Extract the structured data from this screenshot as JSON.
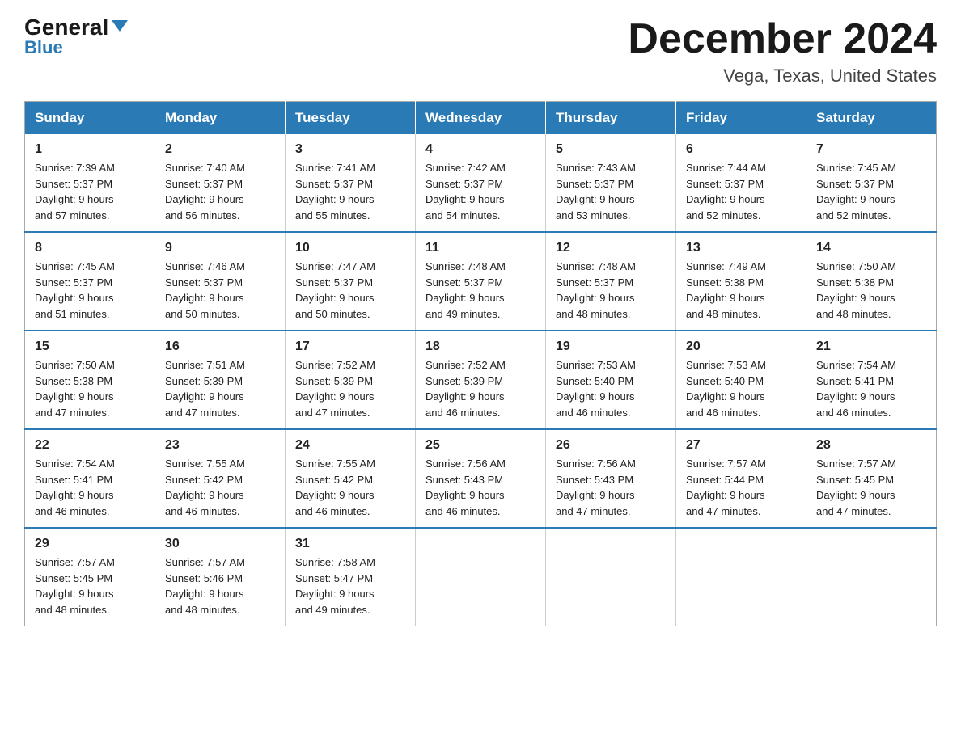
{
  "header": {
    "logo_general": "General",
    "logo_blue": "Blue",
    "month_title": "December 2024",
    "location": "Vega, Texas, United States"
  },
  "days_of_week": [
    "Sunday",
    "Monday",
    "Tuesday",
    "Wednesday",
    "Thursday",
    "Friday",
    "Saturday"
  ],
  "weeks": [
    [
      {
        "day": "1",
        "sunrise": "7:39 AM",
        "sunset": "5:37 PM",
        "daylight": "9 hours and 57 minutes."
      },
      {
        "day": "2",
        "sunrise": "7:40 AM",
        "sunset": "5:37 PM",
        "daylight": "9 hours and 56 minutes."
      },
      {
        "day": "3",
        "sunrise": "7:41 AM",
        "sunset": "5:37 PM",
        "daylight": "9 hours and 55 minutes."
      },
      {
        "day": "4",
        "sunrise": "7:42 AM",
        "sunset": "5:37 PM",
        "daylight": "9 hours and 54 minutes."
      },
      {
        "day": "5",
        "sunrise": "7:43 AM",
        "sunset": "5:37 PM",
        "daylight": "9 hours and 53 minutes."
      },
      {
        "day": "6",
        "sunrise": "7:44 AM",
        "sunset": "5:37 PM",
        "daylight": "9 hours and 52 minutes."
      },
      {
        "day": "7",
        "sunrise": "7:45 AM",
        "sunset": "5:37 PM",
        "daylight": "9 hours and 52 minutes."
      }
    ],
    [
      {
        "day": "8",
        "sunrise": "7:45 AM",
        "sunset": "5:37 PM",
        "daylight": "9 hours and 51 minutes."
      },
      {
        "day": "9",
        "sunrise": "7:46 AM",
        "sunset": "5:37 PM",
        "daylight": "9 hours and 50 minutes."
      },
      {
        "day": "10",
        "sunrise": "7:47 AM",
        "sunset": "5:37 PM",
        "daylight": "9 hours and 50 minutes."
      },
      {
        "day": "11",
        "sunrise": "7:48 AM",
        "sunset": "5:37 PM",
        "daylight": "9 hours and 49 minutes."
      },
      {
        "day": "12",
        "sunrise": "7:48 AM",
        "sunset": "5:37 PM",
        "daylight": "9 hours and 48 minutes."
      },
      {
        "day": "13",
        "sunrise": "7:49 AM",
        "sunset": "5:38 PM",
        "daylight": "9 hours and 48 minutes."
      },
      {
        "day": "14",
        "sunrise": "7:50 AM",
        "sunset": "5:38 PM",
        "daylight": "9 hours and 48 minutes."
      }
    ],
    [
      {
        "day": "15",
        "sunrise": "7:50 AM",
        "sunset": "5:38 PM",
        "daylight": "9 hours and 47 minutes."
      },
      {
        "day": "16",
        "sunrise": "7:51 AM",
        "sunset": "5:39 PM",
        "daylight": "9 hours and 47 minutes."
      },
      {
        "day": "17",
        "sunrise": "7:52 AM",
        "sunset": "5:39 PM",
        "daylight": "9 hours and 47 minutes."
      },
      {
        "day": "18",
        "sunrise": "7:52 AM",
        "sunset": "5:39 PM",
        "daylight": "9 hours and 46 minutes."
      },
      {
        "day": "19",
        "sunrise": "7:53 AM",
        "sunset": "5:40 PM",
        "daylight": "9 hours and 46 minutes."
      },
      {
        "day": "20",
        "sunrise": "7:53 AM",
        "sunset": "5:40 PM",
        "daylight": "9 hours and 46 minutes."
      },
      {
        "day": "21",
        "sunrise": "7:54 AM",
        "sunset": "5:41 PM",
        "daylight": "9 hours and 46 minutes."
      }
    ],
    [
      {
        "day": "22",
        "sunrise": "7:54 AM",
        "sunset": "5:41 PM",
        "daylight": "9 hours and 46 minutes."
      },
      {
        "day": "23",
        "sunrise": "7:55 AM",
        "sunset": "5:42 PM",
        "daylight": "9 hours and 46 minutes."
      },
      {
        "day": "24",
        "sunrise": "7:55 AM",
        "sunset": "5:42 PM",
        "daylight": "9 hours and 46 minutes."
      },
      {
        "day": "25",
        "sunrise": "7:56 AM",
        "sunset": "5:43 PM",
        "daylight": "9 hours and 46 minutes."
      },
      {
        "day": "26",
        "sunrise": "7:56 AM",
        "sunset": "5:43 PM",
        "daylight": "9 hours and 47 minutes."
      },
      {
        "day": "27",
        "sunrise": "7:57 AM",
        "sunset": "5:44 PM",
        "daylight": "9 hours and 47 minutes."
      },
      {
        "day": "28",
        "sunrise": "7:57 AM",
        "sunset": "5:45 PM",
        "daylight": "9 hours and 47 minutes."
      }
    ],
    [
      {
        "day": "29",
        "sunrise": "7:57 AM",
        "sunset": "5:45 PM",
        "daylight": "9 hours and 48 minutes."
      },
      {
        "day": "30",
        "sunrise": "7:57 AM",
        "sunset": "5:46 PM",
        "daylight": "9 hours and 48 minutes."
      },
      {
        "day": "31",
        "sunrise": "7:58 AM",
        "sunset": "5:47 PM",
        "daylight": "9 hours and 49 minutes."
      },
      null,
      null,
      null,
      null
    ]
  ],
  "labels": {
    "sunrise": "Sunrise:",
    "sunset": "Sunset:",
    "daylight": "Daylight:"
  }
}
